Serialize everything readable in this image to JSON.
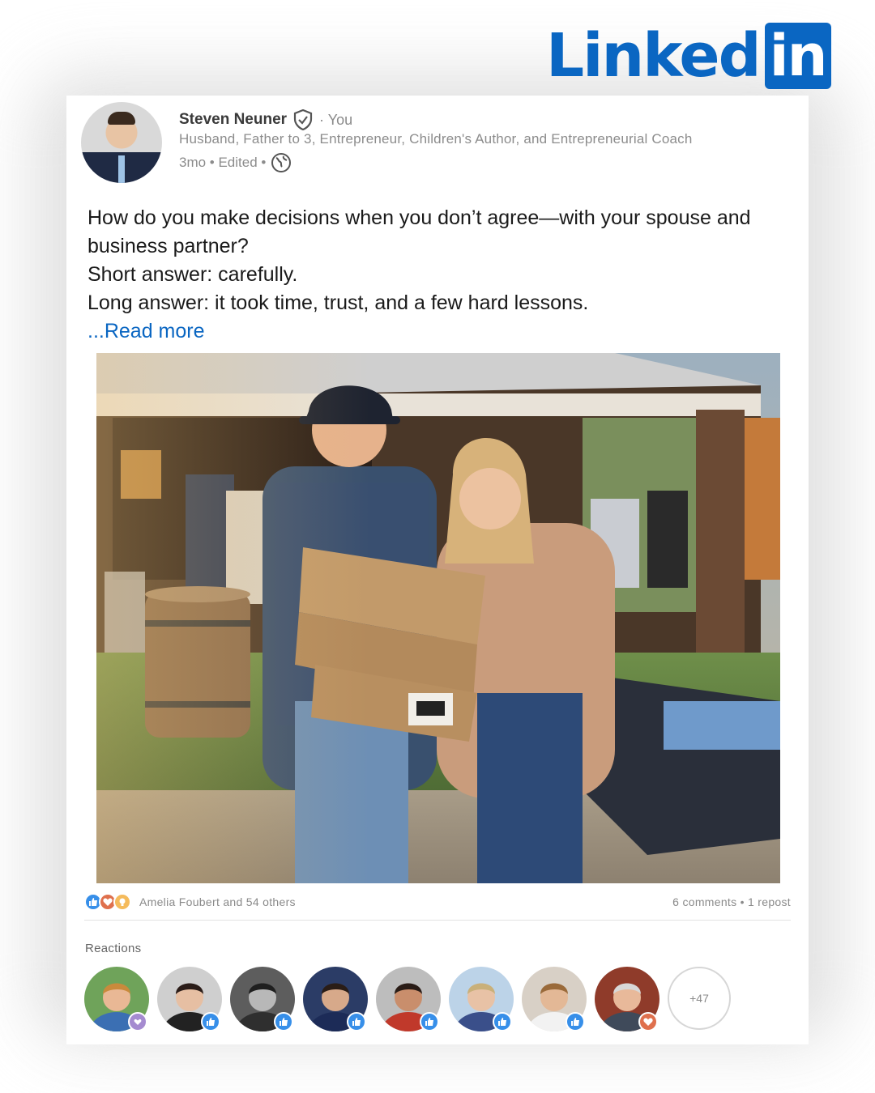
{
  "brand": {
    "wordmark": "Linked",
    "box_text": "in",
    "color": "#0a66c2"
  },
  "post": {
    "author": {
      "name": "Steven Neuner",
      "verified_icon": "shield-check-icon",
      "relation": "· You",
      "headline": "Husband, Father to 3, Entrepreneur, Children's Author, and Entrepreneurial Coach",
      "timestamp": "3mo • Edited •",
      "visibility_icon": "globe-icon"
    },
    "body": {
      "lines": [
        "How do you make decisions when you don’t agree—with your spouse and business partner?",
        "Short answer: carefully.",
        "Long answer: it took time, trust, and a few hard lessons."
      ],
      "read_more": "...Read more"
    },
    "image": {
      "description_icon": "photo"
    },
    "social": {
      "reaction_types": [
        "like",
        "love",
        "insightful"
      ],
      "reactors_text": "Amelia Foubert and 54 others",
      "counts_text": "6 comments • 1 repost"
    },
    "reactions_section": {
      "label": "Reactions",
      "people": [
        {
          "badge": "support",
          "badge_color": "#a58bd0",
          "skin": "#e9b895",
          "bg": "#6fa35a",
          "shirt": "#3b6fb3",
          "hair": "#c98a3c"
        },
        {
          "badge": "like",
          "badge_color": "#378fe9",
          "skin": "#e6bfa3",
          "bg": "#cfcfcf",
          "shirt": "#222222",
          "hair": "#2b1d19"
        },
        {
          "badge": "like",
          "badge_color": "#378fe9",
          "skin": "#b8b8b8",
          "bg": "#5d5d5d",
          "shirt": "#2f2f2f",
          "hair": "#1f1f1f"
        },
        {
          "badge": "like",
          "badge_color": "#378fe9",
          "skin": "#d7a98a",
          "bg": "#2b3c66",
          "shirt": "#1c2b57",
          "hair": "#2a1d17"
        },
        {
          "badge": "like",
          "badge_color": "#378fe9",
          "skin": "#c98e6c",
          "bg": "#bdbdbd",
          "shirt": "#c0392b",
          "hair": "#2a1d17"
        },
        {
          "badge": "like",
          "badge_color": "#378fe9",
          "skin": "#e8c2a6",
          "bg": "#bcd3e8",
          "shirt": "#3a4f8a",
          "hair": "#c9b07a"
        },
        {
          "badge": "like",
          "badge_color": "#378fe9",
          "skin": "#e3b896",
          "bg": "#d8d0c6",
          "shirt": "#f2f2f2",
          "hair": "#9a6a3a"
        },
        {
          "badge": "love",
          "badge_color": "#df704d",
          "skin": "#e8b99a",
          "bg": "#8f3b2a",
          "shirt": "#3f4a5a",
          "hair": "#d8d8d8"
        }
      ],
      "more_label": "+47"
    }
  }
}
